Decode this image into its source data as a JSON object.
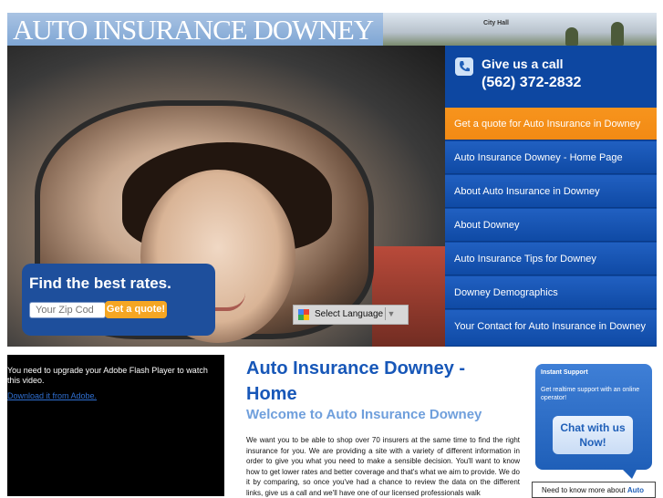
{
  "header": {
    "title": "AUTO INSURANCE DOWNEY",
    "photo_sign": "City Hall"
  },
  "hero": {
    "rates_title": "Find the best rates.",
    "zip_placeholder": "Your Zip Cod",
    "quote_button": "Get a quote!",
    "language_label": "Select Language",
    "language_arrow": "▼"
  },
  "call": {
    "line1": "Give us a call",
    "line2": "(562) 372-2832"
  },
  "nav": {
    "items": [
      {
        "label": "Get a quote for Auto Insurance in Downey"
      },
      {
        "label": "Auto Insurance Downey - Home Page"
      },
      {
        "label": "About Auto Insurance in Downey"
      },
      {
        "label": "About Downey"
      },
      {
        "label": "Auto Insurance Tips for Downey"
      },
      {
        "label": "Downey Demographics"
      },
      {
        "label": "Your Contact for Auto Insurance in Downey"
      }
    ]
  },
  "flash": {
    "message": "You need to upgrade your Adobe Flash Player to watch this video.",
    "link": "Download it from Adobe."
  },
  "main": {
    "heading": "Auto Insurance Downey - Home",
    "subheading": "Welcome to Auto Insurance Downey",
    "body": "We want you to be able to shop over 70 insurers at the same time to find the right insurance for you. We are providing a site with a variety of different information in order to give you what you need to make a sensible decision. You'll want to know how to get lower rates and better coverage and that's what we aim to provide. We do it by comparing, so once you've had a chance to review the data on the different links, give us a call and we'll have one of our licensed professionals walk"
  },
  "support": {
    "title": "Instant Support",
    "subtitle": "Get realtime support with an online operator!",
    "chat_button": "Chat with us Now!"
  },
  "know_more": {
    "text": "Need to know more about ",
    "link": "Auto"
  },
  "colors": {
    "nav_blue": "#0d47a1",
    "nav_active": "#f7941d",
    "heading_blue": "#1757b8",
    "subheading_blue": "#6f9fdc"
  }
}
